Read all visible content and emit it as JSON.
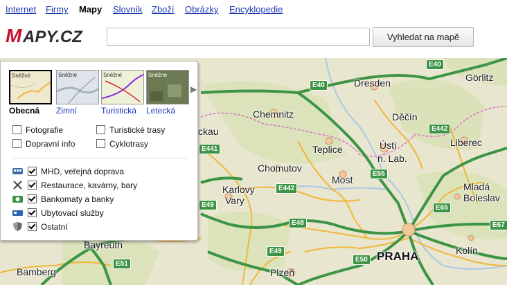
{
  "nav": {
    "items": [
      {
        "label": "Internet",
        "active": false
      },
      {
        "label": "Firmy",
        "active": false
      },
      {
        "label": "Mapy",
        "active": true
      },
      {
        "label": "Slovník",
        "active": false
      },
      {
        "label": "Zboží",
        "active": false
      },
      {
        "label": "Obrázky",
        "active": false
      },
      {
        "label": "Encyklopedie",
        "active": false
      }
    ]
  },
  "logo": {
    "text": "Mapy.cz",
    "accent_color": "#c8102e"
  },
  "search": {
    "value": "",
    "placeholder": "",
    "button_label": "Vyhledat na mapě"
  },
  "map": {
    "cities": {
      "dresden": "Dresden",
      "gorlitz": "Görlitz",
      "chemnitz": "Chemnitz",
      "decin": "Děčín",
      "ckau": "ckau",
      "teplice": "Teplice",
      "usti": "Ústí",
      "usti2": "n. Lab.",
      "liberec": "Liberec",
      "chomutov": "Chomutov",
      "most": "Most",
      "karlovy": "Karlovy",
      "vary": "Vary",
      "mlada": "Mladá",
      "boleslav": "Boleslav",
      "bayreuth": "Bayreuth",
      "praha": "PRAHA",
      "kolin": "Kolín",
      "bamberg": "Bamberg",
      "plzen": "Plzeň"
    },
    "roads": {
      "e40a": "E40",
      "e40b": "E40",
      "e442a": "E442",
      "e441": "E441",
      "e55": "E55",
      "e442b": "E442",
      "e49a": "E49",
      "e65": "E65",
      "e48": "E48",
      "e67": "E67",
      "e49b": "E49",
      "e50": "E50",
      "e51": "E51"
    },
    "colors": {
      "land": "#e9e6cf",
      "motorway": "#3c9445",
      "main_road": "#f0b63a",
      "water": "#a9c8e6",
      "border": "#d97ac4"
    }
  },
  "panel": {
    "map_types": [
      {
        "label": "Obecná",
        "thumb_text": "Sněžné",
        "active": true
      },
      {
        "label": "Zimní",
        "thumb_text": "Sněžné",
        "active": false
      },
      {
        "label": "Turistická",
        "thumb_text": "Sněžné",
        "active": false
      },
      {
        "label": "Letecká",
        "thumb_text": "Sněžné",
        "active": false
      }
    ],
    "layers": [
      {
        "label": "Fotografie",
        "checked": false
      },
      {
        "label": "Turistické trasy",
        "checked": false
      },
      {
        "label": "Dopravní info",
        "checked": false
      },
      {
        "label": "Cyklotrasy",
        "checked": false
      }
    ],
    "poi": [
      {
        "label": "MHD, veřejná doprava",
        "checked": true,
        "icon": "bus-icon"
      },
      {
        "label": "Restaurace, kavárny, bary",
        "checked": true,
        "icon": "cutlery-icon"
      },
      {
        "label": "Bankomaty a banky",
        "checked": true,
        "icon": "bank-icon"
      },
      {
        "label": "Ubytovací služby",
        "checked": true,
        "icon": "bed-icon"
      },
      {
        "label": "Ostatní",
        "checked": true,
        "icon": "shield-icon"
      }
    ]
  }
}
